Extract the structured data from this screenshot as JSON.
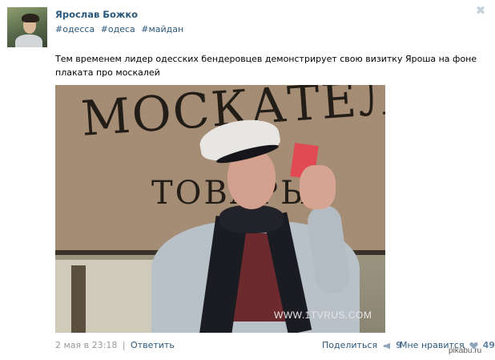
{
  "post": {
    "author": "Ярослав Божко",
    "hashtags": [
      "#одесса",
      "#одеса",
      "#майдан"
    ],
    "text": "Тем временем лидер одесских бендеровцев демонстрирует свою визитку Яроша на фоне плаката про москалей",
    "photo": {
      "sign_line1": "МОСКАТЕЛ",
      "sign_line2": "ТОВАРЫ",
      "watermark": "WWW.1TVRUS.COM"
    }
  },
  "footer": {
    "date": "2 мая в 23:18",
    "separator": "|",
    "reply_label": "Ответить",
    "share_label": "Поделиться",
    "share_count": "9",
    "like_label": "Мне нравится",
    "like_count": "49"
  },
  "icons": {
    "close": "close-icon",
    "share": "megaphone-icon",
    "like": "heart-icon"
  },
  "colors": {
    "link": "#2b587a",
    "muted": "#999999",
    "counter": "#6384a3"
  },
  "watermark_site": "pikabu.ru"
}
